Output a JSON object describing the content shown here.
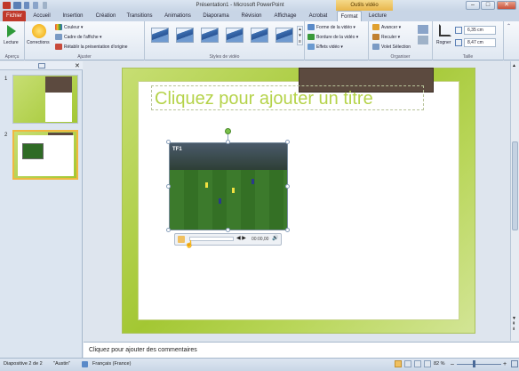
{
  "titlebar": {
    "window_title": "Présentation1 - Microsoft PowerPoint",
    "context_tab": "Outils vidéo"
  },
  "tabs": [
    "Fichier",
    "Accueil",
    "Insertion",
    "Création",
    "Transitions",
    "Animations",
    "Diaporama",
    "Révision",
    "Affichage",
    "Acrobat",
    "Format",
    "Lecture"
  ],
  "ribbon": {
    "apercu": {
      "button": "Lecture",
      "group": "Aperçu"
    },
    "ajuster": {
      "corrections": "Corrections",
      "couleur": "Couleur",
      "cadre": "Cadre de l'affiche",
      "retablir": "Rétablir la présentation d'origine",
      "group": "Ajuster"
    },
    "styles": {
      "group": "Styles de vidéo"
    },
    "video_opts": {
      "forme": "Forme de la vidéo",
      "bordure": "Bordure de la vidéo",
      "effets": "Effets vidéo"
    },
    "organiser": {
      "avancer": "Avancer",
      "reculer": "Reculer",
      "volet": "Volet Sélection",
      "group": "Organiser"
    },
    "taille": {
      "rogner": "Rogner",
      "height": "6,35 cm",
      "width": "8,47 cm",
      "group": "Taille"
    }
  },
  "slides_panel": {
    "tab_slides_icon": "slides-icon",
    "tab_outline_icon": "outline-icon",
    "numbers": [
      "1",
      "2"
    ]
  },
  "slide": {
    "title_placeholder": "Cliquez pour ajouter un titre",
    "video_time": "00:00,00"
  },
  "notes": {
    "placeholder": "Cliquez pour ajouter des commentaires"
  },
  "status": {
    "slide_info": "Diapositive 2 de 2",
    "theme": "\"Austin\"",
    "language": "Français (France)",
    "zoom": "82 %"
  },
  "colors": {
    "accent": "#b5d34a",
    "file_tab": "#c0392b",
    "ribbon": "#dfe7f1"
  }
}
